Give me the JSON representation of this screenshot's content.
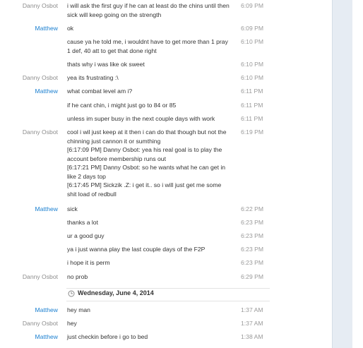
{
  "messages": [
    {
      "sender": "Danny Osbot",
      "text": "i will ask the first guy if he can at least do the chins until then\nsick will keep going on the strength",
      "time": "6:09 PM"
    },
    {
      "sender": "Matthew",
      "text": "ok",
      "time": "6:09 PM"
    },
    {
      "sender": "",
      "text": "cause ya he told me, i wouldnt have to get more than 1 pray\n1 def, 40 att to get that done right",
      "time": "6:10 PM"
    },
    {
      "sender": "",
      "text": "thats why i was like ok sweet",
      "time": "6:10 PM"
    },
    {
      "sender": "Danny Osbot",
      "text": "yea its frustrating :\\",
      "time": "6:10 PM"
    },
    {
      "sender": "Matthew",
      "text": "what combat level am i?",
      "time": "6:11 PM"
    },
    {
      "sender": "",
      "text": "if he cant chin, i might just go to 84 or 85",
      "time": "6:11 PM"
    },
    {
      "sender": "",
      "text": "unless im super busy in the next couple days with work",
      "time": "6:11 PM"
    },
    {
      "sender": "Danny Osbot",
      "text": "cool i wil just keep at it then i can do that though but not the\nchinning just cannon it or sumthing\n[6:17:09 PM] Danny Osbot: yea his real goal is to play the\naccount before membership runs out\n[6:17:21 PM] Danny Osbot: so he wants what he can get in\nlike 2 days top\n[6:17:45 PM] Sickzik .Z: i get it.. so i will just get me some\nshit load of redbull",
      "time": "6:19 PM"
    },
    {
      "sender": "Matthew",
      "text": "sick",
      "time": "6:22 PM"
    },
    {
      "sender": "",
      "text": "thanks a lot",
      "time": "6:23 PM"
    },
    {
      "sender": "",
      "text": "ur a good guy",
      "time": "6:23 PM"
    },
    {
      "sender": "",
      "text": "ya i just wanna play the last couple days of the F2P",
      "time": "6:23 PM"
    },
    {
      "sender": "",
      "text": "i hope it is perm",
      "time": "6:23 PM"
    },
    {
      "sender": "Danny Osbot",
      "text": "no prob",
      "time": "6:29 PM"
    },
    {
      "sender": "Matthew",
      "text": "hey man",
      "time": "1:37 AM"
    },
    {
      "sender": "Danny Osbot",
      "text": "hey",
      "time": "1:37 AM"
    },
    {
      "sender": "Matthew",
      "text": "just checkin before i go to bed",
      "time": "1:38 AM"
    }
  ],
  "date_separator": {
    "label": "Wednesday, June 4, 2014",
    "icon": "clock-icon"
  },
  "colors": {
    "matthew": "#1a7fd0",
    "danny": "#8c8c8c",
    "text": "#333333",
    "time": "#9a9a9a"
  }
}
